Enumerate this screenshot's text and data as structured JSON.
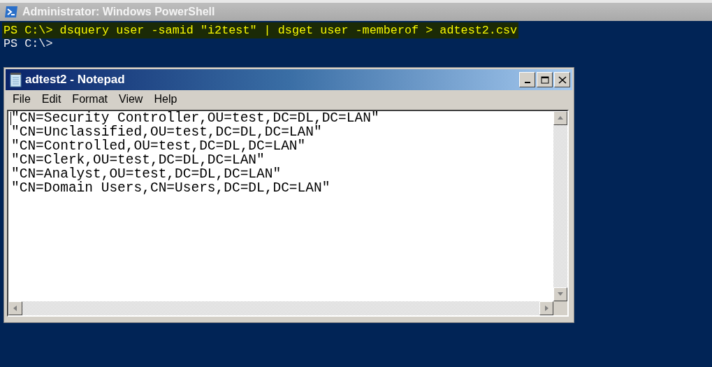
{
  "powershell": {
    "title": "Administrator: Windows PowerShell",
    "lines": [
      {
        "text": "PS C:\\> dsquery user -samid \"i2test\" | dsget user -memberof > adtest2.csv",
        "highlighted": true
      },
      {
        "text": "PS C:\\>",
        "highlighted": false
      }
    ]
  },
  "notepad": {
    "title": "adtest2 - Notepad",
    "menu": [
      "File",
      "Edit",
      "Format",
      "View",
      "Help"
    ],
    "lines": [
      "\"CN=Security Controller,OU=test,DC=DL,DC=LAN\"",
      "\"CN=Unclassified,OU=test,DC=DL,DC=LAN\"",
      "\"CN=Controlled,OU=test,DC=DL,DC=LAN\"",
      "\"CN=Clerk,OU=test,DC=DL,DC=LAN\"",
      "\"CN=Analyst,OU=test,DC=DL,DC=LAN\"",
      "\"CN=Domain Users,CN=Users,DC=DL,DC=LAN\""
    ]
  }
}
